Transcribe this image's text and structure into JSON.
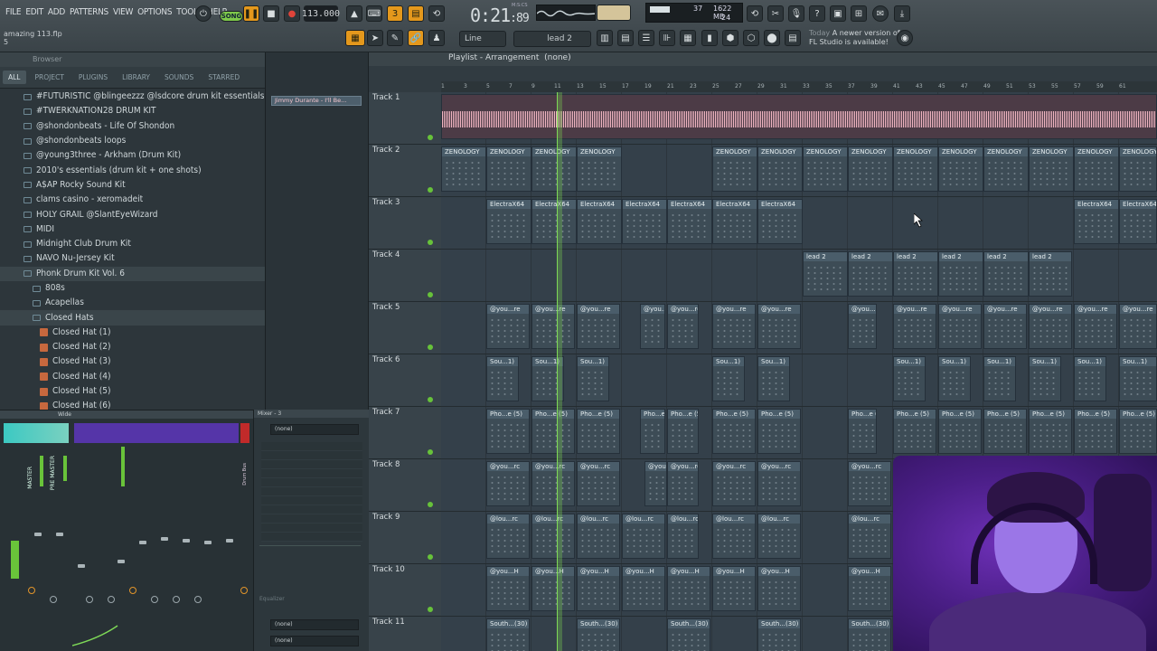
{
  "menu": [
    "FILE",
    "EDIT",
    "ADD",
    "PATTERNS",
    "VIEW",
    "OPTIONS",
    "TOOLS",
    "HELP"
  ],
  "hint": {
    "title": "amazing 113.flp",
    "sub": "5"
  },
  "transport": {
    "song_label": "SONG",
    "tempo": "113.000",
    "time_main": "0:21",
    "time_frac": ":89",
    "time_label": "M:S:CS"
  },
  "cpu": {
    "val1": "37",
    "val2": "1622 MB",
    "val3": "24"
  },
  "snap": {
    "line_label": "Line",
    "pattern_label": "lead 2"
  },
  "news": {
    "today": "Today",
    "msg1": "A newer version of",
    "msg2": "FL Studio is available!"
  },
  "browser": {
    "title": "Browser",
    "tabs": [
      "ALL",
      "PROJECT",
      "PLUGINS",
      "LIBRARY",
      "SOUNDS",
      "STARRED"
    ],
    "folders": [
      "#FUTURISTIC @blingeezzz @lsdcore drum kit essentials",
      "#TWERKNATION28 DRUM KIT",
      "@shondonbeats - Life Of Shondon",
      "@shondonbeats loops",
      "@young3three - Arkham (Drum Kit)",
      "2010's essentials (drum kit + one shots)",
      "A$AP Rocky Sound Kit",
      "clams casino - xeromadeit",
      "HOLY GRAIL @SlantEyeWizard",
      "MIDI",
      "Midnight Club Drum Kit",
      "NAVO Nu-Jersey Kit",
      "Phonk Drum Kit Vol. 6"
    ],
    "subfolders": [
      "808s",
      "Acapellas",
      "Closed Hats"
    ],
    "files": [
      "Closed Hat (1)",
      "Closed Hat (2)",
      "Closed Hat (3)",
      "Closed Hat (4)",
      "Closed Hat (5)",
      "Closed Hat (6)"
    ]
  },
  "pattern_strip": {
    "clip": "Jimmy Durante - I'll Be..."
  },
  "playlist": {
    "title": "Playlist - Arrangement",
    "subtitle": "(none)",
    "ruler": [
      "1",
      "3",
      "5",
      "7",
      "9",
      "11",
      "13",
      "15",
      "17",
      "19",
      "21",
      "23",
      "25",
      "27",
      "29",
      "31",
      "33",
      "35",
      "37",
      "39",
      "41",
      "43",
      "45",
      "47",
      "49",
      "51",
      "53",
      "55",
      "57",
      "59",
      "61"
    ],
    "tracks": [
      "Track 1",
      "Track 2",
      "Track 3",
      "Track 4",
      "Track 5",
      "Track 6",
      "Track 7",
      "Track 8",
      "Track 9",
      "Track 10",
      "Track 11"
    ],
    "clip_names": {
      "t2": "ZENOLOGY",
      "t3": "ElectraX64",
      "t4": "lead 2",
      "t5": "@you...re",
      "t6": "Sou...1)",
      "t7": "Pho...e (5)",
      "t8": "@you...rc",
      "t9": "@lou...rc",
      "t10": "@you...H",
      "t11": "South...(30)"
    }
  },
  "mixer": {
    "title": "Wide",
    "master": "MASTER",
    "pre_master": "PRE MASTER",
    "mixer_title": "Mixer - 3",
    "slot_none": "(none)",
    "eq_label": "Equalizer",
    "bus": "Drum Bus"
  }
}
